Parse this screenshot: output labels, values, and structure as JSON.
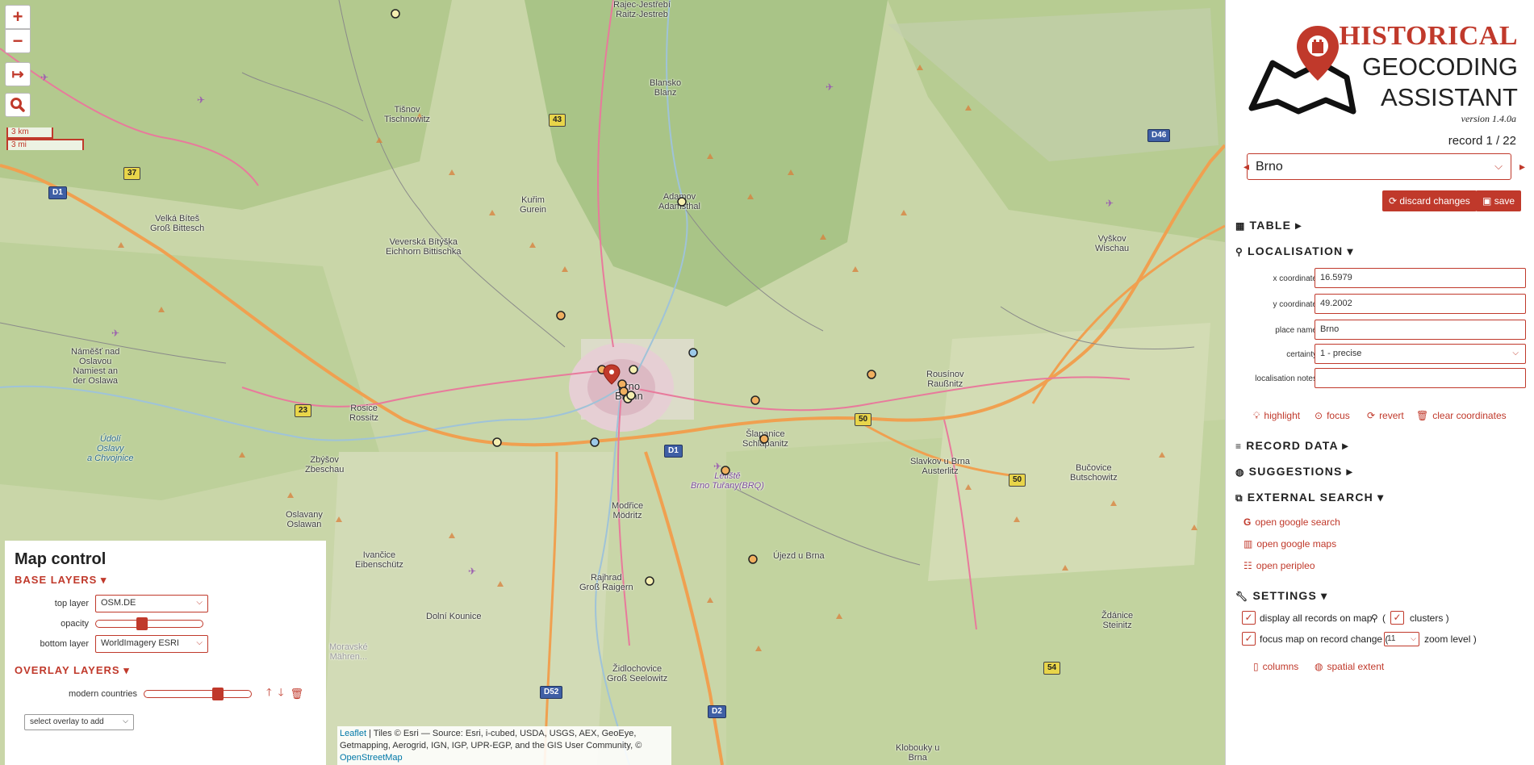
{
  "map": {
    "zoom_in": "+",
    "zoom_out": "−",
    "scale_km": "3 km",
    "scale_mi": "3 mi",
    "places": {
      "rajec": "Rajec-Jestřebí\nRaitz-Jestreb",
      "blansko": "Blansko\nBlanz",
      "tisnov": "Tišnov\nTischnowitz",
      "velka_bites": "Velká Bíteš\nGroß Bittesch",
      "kurim": "Kuřim\nGurein",
      "adamov": "Adamov\nAdamsthal",
      "veverska": "Veverská Bítýška\nEichhorn Bittischka",
      "namest": "Náměšť nad\nOslavou\nNamiest an\nder Oslawa",
      "rosice": "Rosice\nRossitz",
      "brno": "Brno\nBrünn",
      "slapanice": "Šlapanice\nSchlapanitz",
      "tuvany": "Letiště\nBrno Tuřany(BRQ)",
      "rousinov": "Rousínov\nRaußnitz",
      "vyskov": "Vyškov\nWischau",
      "slavkov": "Slavkov u Brna\nAusterlitz",
      "bucovice": "Bučovice\nButschowitz",
      "velke_ujezd": "Újezd u Brna",
      "modrice": "Modřice\nMödritz",
      "rajhrad": "Rajhrad\nGroß Raigern",
      "zbysov": "Zbýšov\nZbeschau",
      "oslavany": "Oslavany\nOslawan",
      "ivancice": "Ivančice\nEibenschütz",
      "dolni_kounice": "Dolní Kounice",
      "zidlochovice": "Židlochovice\nGroß Seelowitz",
      "zdanice": "Ždánice\nSteinitz",
      "klobouky": "Klobouky u\nBrna",
      "udolni": "Údolí\nOslavy\na Chvojnice",
      "moravske": "Moravské\nMähren..."
    },
    "shields": {
      "d1_west": "D1",
      "r37": "37",
      "r43": "43",
      "r23": "23",
      "d1_center": "D1",
      "r50a": "50",
      "r50b": "50",
      "d46": "D46",
      "d52": "D52",
      "d2": "D2",
      "r54": "54"
    }
  },
  "map_control": {
    "title": "Map control",
    "base_layers": "BASE LAYERS",
    "top_layer_label": "top layer",
    "top_layer_value": "OSM.DE",
    "opacity_label": "opacity",
    "opacity_value": 0.42,
    "bottom_layer_label": "bottom layer",
    "bottom_layer_value": "WorldImagery ESRI",
    "overlay_layers": "OVERLAY LAYERS",
    "overlay_name": "modern countries",
    "overlay_opacity": 0.7,
    "overlay_select_placeholder": "select overlay to add"
  },
  "attribution": {
    "leaflet": "Leaflet",
    "text": " | Tiles © Esri — Source: Esri, i-cubed, USDA, USGS, AEX, GeoEye, Getmapping, Aerogrid, IGN, IGP, UPR-EGP, and the GIS User Community, © ",
    "osm": "OpenStreetMap"
  },
  "sidebar": {
    "logo_line1": "HISTORICAL",
    "logo_line2": "GEOCODING",
    "logo_line3": "ASSISTANT",
    "version": "version 1.4.0a",
    "record_counter": "record 1 / 22",
    "record_selected": "Brno",
    "discard_label": "discard changes",
    "save_label": "save",
    "table_heading": "TABLE",
    "localisation_heading": "LOCALISATION",
    "fields": {
      "x_label": "x coordinate",
      "x_value": "16.5979",
      "y_label": "y coordinate",
      "y_value": "49.2002",
      "place_label": "place name",
      "place_value": "Brno",
      "certainty_label": "certainty",
      "certainty_value": "1 - precise",
      "notes_label": "localisation notes",
      "notes_value": ""
    },
    "actions": {
      "highlight": "highlight",
      "focus": "focus",
      "revert": "revert",
      "clear": "clear coordinates"
    },
    "record_data_heading": "RECORD DATA",
    "suggestions_heading": "SUGGESTIONS",
    "external_search_heading": "EXTERNAL SEARCH",
    "external": {
      "google_search": "open google search",
      "google_maps": "open google maps",
      "peripleo": "open peripleo"
    },
    "settings_heading": "SETTINGS",
    "settings": {
      "display_all": "display all records on map",
      "paren_open": "(",
      "clusters": "clusters )",
      "focus_map": "focus map on record change (",
      "zoom_value": "11",
      "zoom_level": "zoom level )",
      "columns": "columns",
      "spatial_extent": "spatial extent"
    }
  },
  "colors": {
    "accent": "#c0392b",
    "map_green": "#c6d3a6",
    "road_orange": "#f0a050",
    "road_pink": "#e87a9c"
  }
}
